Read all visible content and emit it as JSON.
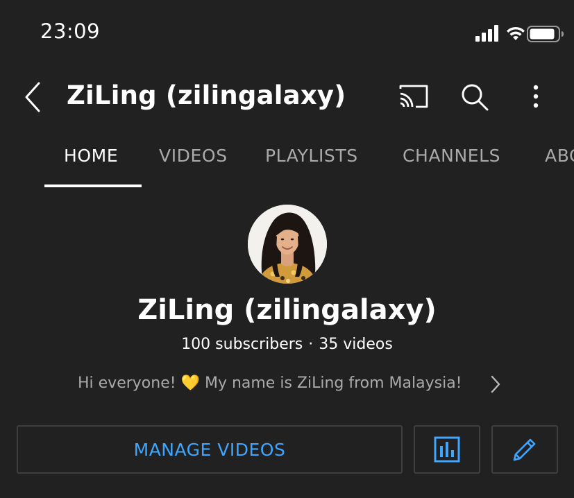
{
  "status_bar": {
    "time": "23:09",
    "icons": [
      "signal-icon",
      "wifi-icon",
      "battery-icon"
    ]
  },
  "header": {
    "title": "ZiLing (zilingalaxy)",
    "icons": [
      "back-icon",
      "cast-icon",
      "search-icon",
      "more-vert-icon"
    ]
  },
  "tabs": [
    {
      "label": "HOME",
      "active": true
    },
    {
      "label": "VIDEOS",
      "active": false
    },
    {
      "label": "PLAYLISTS",
      "active": false
    },
    {
      "label": "CHANNELS",
      "active": false
    },
    {
      "label": "ABO",
      "active": false
    }
  ],
  "channel": {
    "name": "ZiLing (zilingalaxy)",
    "subscribers": "100 subscribers",
    "separator": "·",
    "videos": "35 videos",
    "about_before": "Hi everyone! ",
    "about_emoji": "💛",
    "about_after": " My name is ZiLing from Malaysia!"
  },
  "actions": {
    "manage_label": "MANAGE VIDEOS",
    "analytics_icon": "analytics-icon",
    "edit_icon": "pencil-icon"
  },
  "colors": {
    "background": "#212121",
    "accent": "#3ea6ff",
    "inactive_text": "#aaaaaa",
    "border": "#3f3f3f"
  }
}
